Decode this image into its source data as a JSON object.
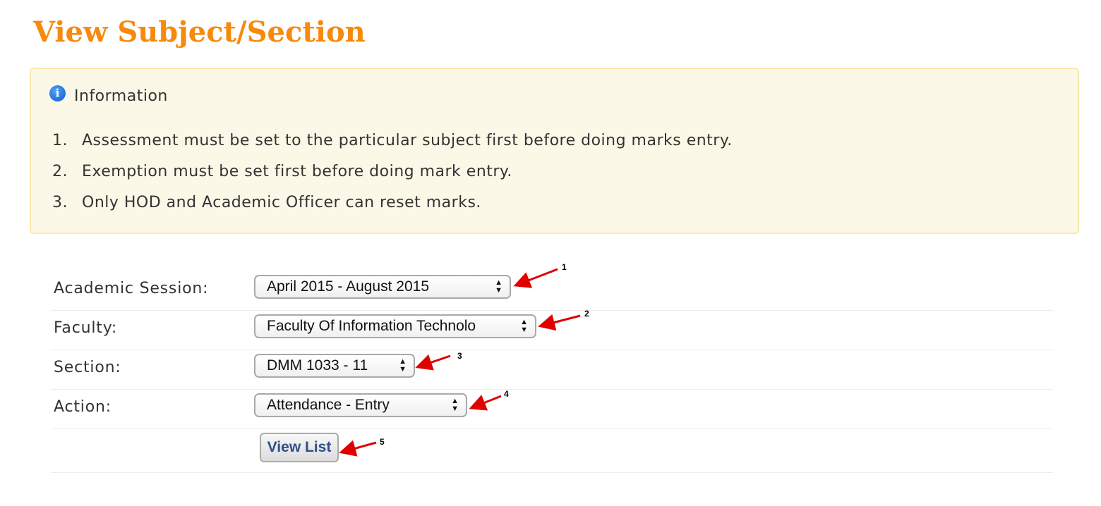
{
  "page": {
    "title": "View Subject/Section"
  },
  "info": {
    "icon": "info-icon",
    "icon_glyph": "i",
    "title": "Information",
    "items": [
      {
        "num": "1.",
        "text": "Assessment must be set to the particular subject first before doing marks entry."
      },
      {
        "num": "2.",
        "text": "Exemption must be set first before doing mark entry."
      },
      {
        "num": "3.",
        "text": "Only HOD and Academic Officer can reset marks."
      }
    ]
  },
  "form": {
    "academic_session": {
      "label": "Academic Session:",
      "value": "April 2015 - August 2015"
    },
    "faculty": {
      "label": "Faculty:",
      "value": "Faculty Of Information Technolo"
    },
    "section": {
      "label": "Section:",
      "value": "DMM 1033 - 11"
    },
    "action": {
      "label": "Action:",
      "value": "Attendance - Entry"
    },
    "view_button": "View List"
  },
  "annotations": [
    "1",
    "2",
    "3",
    "4",
    "5"
  ],
  "colors": {
    "title": "#f7890c",
    "info_bg": "#fcf8e8",
    "info_border": "#f9e9a8",
    "arrow": "#e00000",
    "button_text": "#2f4f8a"
  }
}
